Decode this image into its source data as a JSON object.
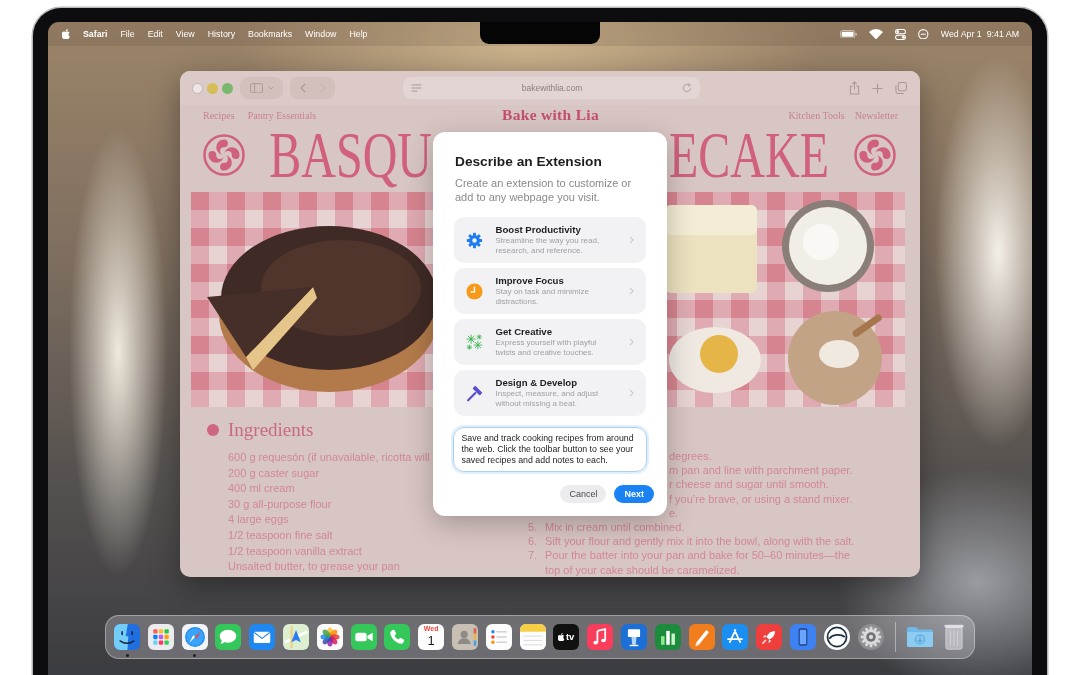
{
  "menu_bar": {
    "app_name": "Safari",
    "menus": [
      "File",
      "Edit",
      "View",
      "History",
      "Bookmarks",
      "Window",
      "Help"
    ],
    "date": "Wed Apr 1",
    "time": "9:41 AM"
  },
  "browser": {
    "address": "bakewithlia.com",
    "page": {
      "nav_left": [
        "Recipes",
        "Pantry Essentials"
      ],
      "site_title": "Bake with Lia",
      "nav_right": [
        "Kitchen Tools",
        "Newsletter"
      ],
      "headline_parts": [
        "BASQU",
        "ECAKE"
      ],
      "ingredients_heading": "Ingredients",
      "ingredients": [
        "600 g requesón (if unavailable, ricotta will",
        "200 g caster sugar",
        "400 ml cream",
        "30 g all-purpose flour",
        "4 large eggs",
        "1/2 teaspoon fine salt",
        "1/2 teaspoon vanilla extract",
        "Unsalted butter, to grease your pan"
      ],
      "step_fragments": [
        "degrees.",
        "m pan and line with parchment paper.",
        "r cheese and sugar until smooth.",
        "f you’re brave, or using a stand mixer.",
        "e."
      ],
      "steps": [
        {
          "number": "5.",
          "text": "Mix in cream until combined."
        },
        {
          "number": "6.",
          "text": "Sift your flour and gently mix it into the bowl, along with the salt."
        },
        {
          "number": "7.",
          "text": "Pour the batter into your pan and bake for 50–60 minutes—the top of your cake should be caramelized."
        }
      ]
    }
  },
  "dialog": {
    "title": "Describe an Extension",
    "subtitle": "Create an extension to customize or add to any webpage you visit.",
    "options": [
      {
        "kind": "gear",
        "title": "Boost Productivity",
        "description": "Streamline the way you read, research, and reference."
      },
      {
        "kind": "clock",
        "title": "Improve Focus",
        "description": "Stay on task and minimize distractions."
      },
      {
        "kind": "sparkle",
        "title": "Get Creative",
        "description": "Express yourself with playful twists and creative touches."
      },
      {
        "kind": "hammer",
        "title": "Design & Develop",
        "description": "Inspect, measure, and adjust without missing a beat."
      }
    ],
    "description_field": {
      "value": "Save and track cooking recipes from around the web. Click the toolbar button to see your saved recipes and add notes to each.",
      "focused": true
    },
    "buttons": [
      {
        "label": "Cancel",
        "kind": "secondary"
      },
      {
        "label": "Next",
        "kind": "primary"
      }
    ]
  },
  "dock": {
    "apps": [
      {
        "kind": "face",
        "running": true
      },
      {
        "kind": "grid",
        "running": false
      },
      {
        "kind": "compass",
        "running": true
      },
      {
        "kind": "bubble",
        "running": false
      },
      {
        "kind": "envelope",
        "running": false
      },
      {
        "kind": "map",
        "running": false
      },
      {
        "kind": "flower",
        "running": false
      },
      {
        "kind": "camera",
        "running": false
      },
      {
        "kind": "phone",
        "running": false
      },
      {
        "kind": "calendar",
        "running": false,
        "day": "Wed",
        "date": "1"
      },
      {
        "kind": "contact",
        "running": false
      },
      {
        "kind": "checklist",
        "running": false
      },
      {
        "kind": "notepad",
        "running": false
      },
      {
        "kind": "tv",
        "running": false,
        "label": "tv"
      },
      {
        "kind": "note",
        "running": false
      },
      {
        "kind": "podium",
        "running": false
      },
      {
        "kind": "chart",
        "running": false
      },
      {
        "kind": "pencil",
        "running": false
      },
      {
        "kind": "store",
        "running": false
      },
      {
        "kind": "rocket",
        "running": false
      },
      {
        "kind": "device",
        "running": false
      },
      {
        "kind": "swoosh",
        "running": false
      },
      {
        "kind": "gear",
        "running": false
      }
    ],
    "stacks": [
      {
        "kind": "folder"
      },
      {
        "kind": "trash"
      }
    ]
  }
}
